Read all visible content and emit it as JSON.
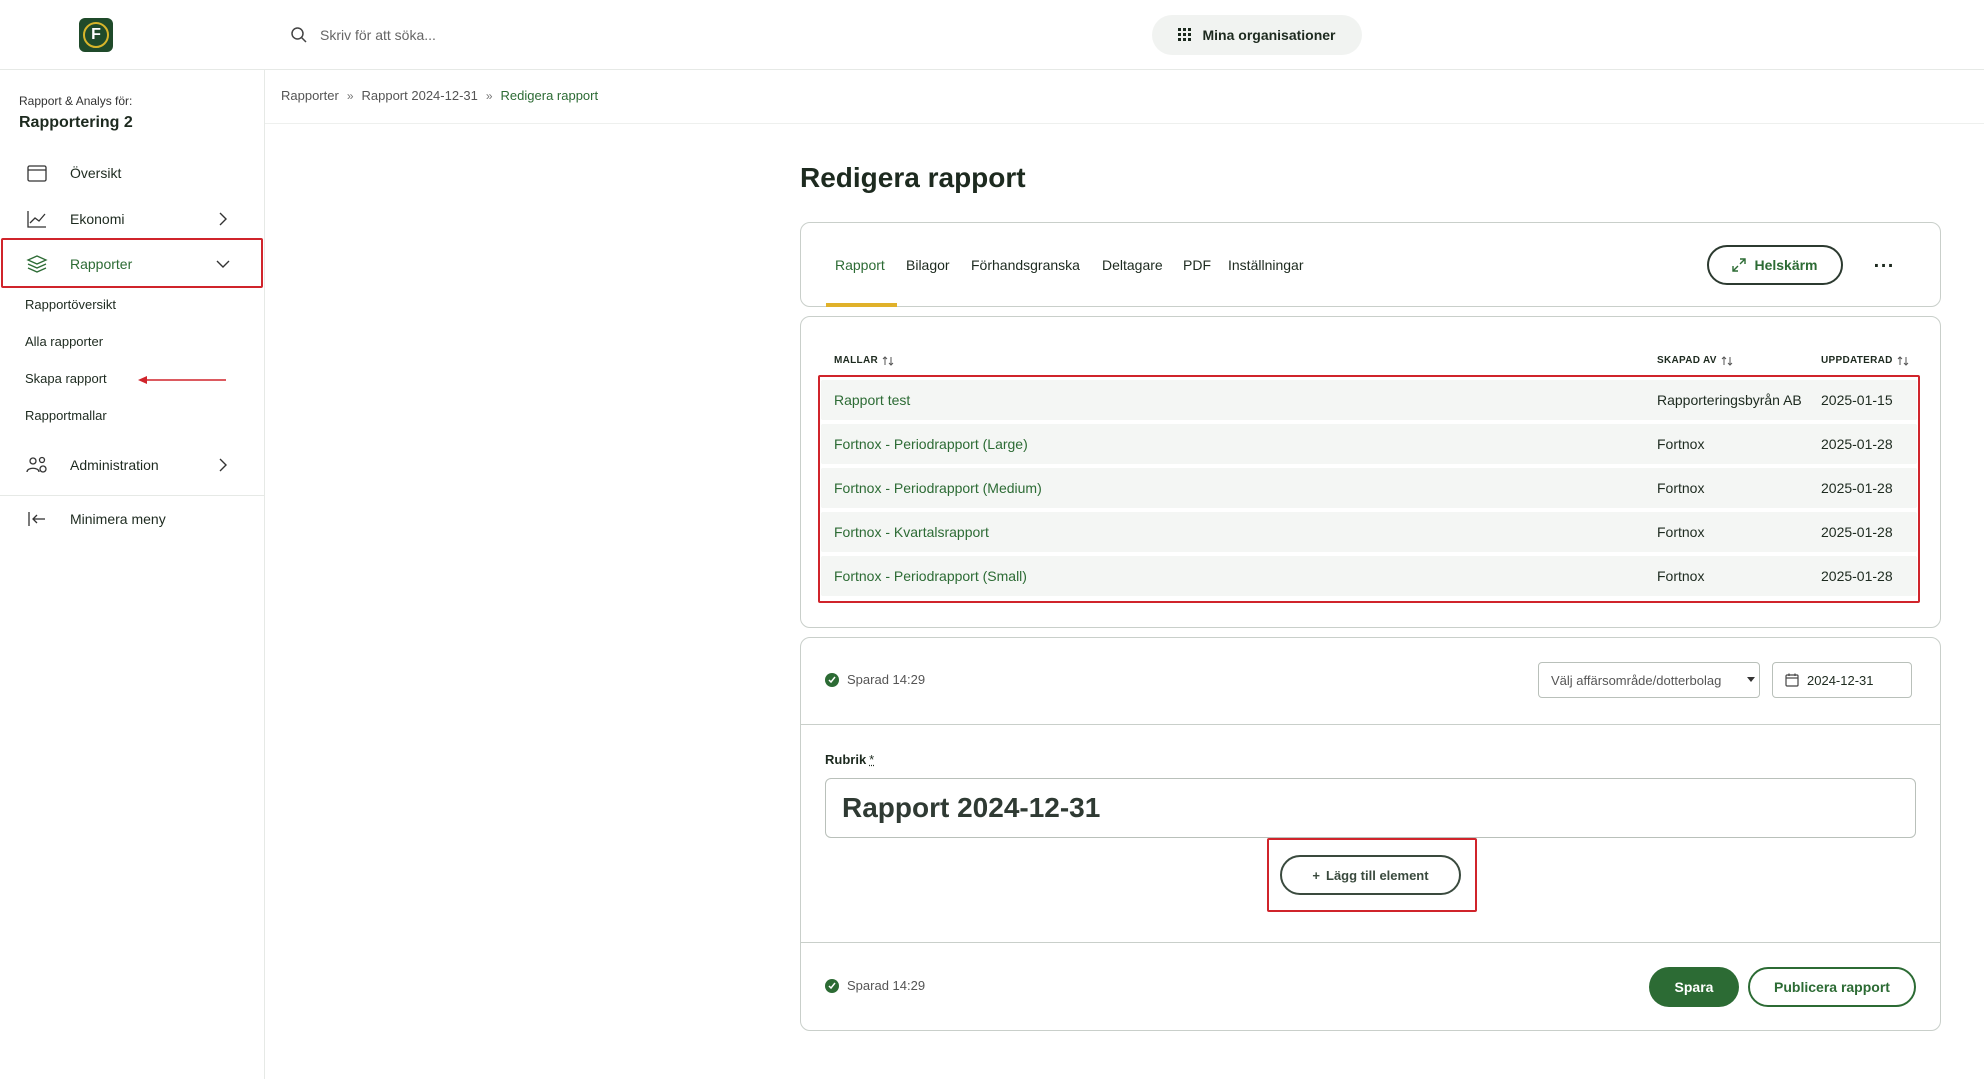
{
  "header": {
    "logo_letter": "F",
    "search_placeholder": "Skriv för att söka...",
    "org_button": "Mina organisationer"
  },
  "sidebar": {
    "context_label": "Rapport & Analys för:",
    "context_name": "Rapportering 2",
    "items": [
      {
        "label": "Översikt",
        "icon": "calendar-icon"
      },
      {
        "label": "Ekonomi",
        "icon": "chart-line-icon"
      },
      {
        "label": "Rapporter",
        "icon": "layers-icon"
      },
      {
        "label": "Administration",
        "icon": "users-gear-icon"
      },
      {
        "label": "Minimera meny",
        "icon": "collapse-left-icon"
      }
    ],
    "sub_items": [
      "Rapportöversikt",
      "Alla rapporter",
      "Skapa rapport",
      "Rapportmallar"
    ]
  },
  "breadcrumb": [
    "Rapporter",
    "Rapport 2024-12-31",
    "Redigera rapport"
  ],
  "page": {
    "title": "Redigera rapport"
  },
  "tabs": [
    "Rapport",
    "Bilagor",
    "Förhandsgranska",
    "Deltagare",
    "PDF",
    "Inställningar"
  ],
  "toolbar": {
    "fullscreen_label": "Helskärm",
    "more_label": "···"
  },
  "templates_table": {
    "columns": [
      "MALLAR",
      "SKAPAD AV",
      "UPPDATERAD"
    ],
    "rows": [
      [
        "Rapport test",
        "Rapporteringsbyrån AB",
        "2025-01-15"
      ],
      [
        "Fortnox - Periodrapport (Large)",
        "Fortnox",
        "2025-01-28"
      ],
      [
        "Fortnox - Periodrapport (Medium)",
        "Fortnox",
        "2025-01-28"
      ],
      [
        "Fortnox - Kvartalsrapport",
        "Fortnox",
        "2025-01-28"
      ],
      [
        "Fortnox - Periodrapport (Small)",
        "Fortnox",
        "2025-01-28"
      ]
    ]
  },
  "editor": {
    "saved_status": "Sparad 14:29",
    "business_area_placeholder": "Välj affärsområde/dotterbolag",
    "date_value": "2024-12-31",
    "title_label": "Rubrik",
    "required_marker": "*",
    "title_value": "Rapport 2024-12-31",
    "add_element_label": "Lägg till element",
    "save_label": "Spara",
    "publish_label": "Publicera rapport"
  },
  "colors": {
    "brand_green": "#2c6b34",
    "accent_yellow": "#e0b12a",
    "annotation_red": "#d0242b"
  }
}
